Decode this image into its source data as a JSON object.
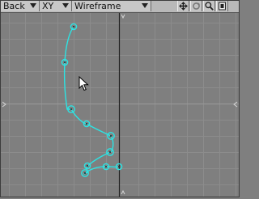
{
  "toolbar": {
    "view_label": "Back",
    "axis_label": "XY",
    "render_mode_label": "Wireframe"
  },
  "icons": {
    "move_view": "move-arrows-icon",
    "rotate_view": "rotate-icon",
    "zoom_view": "magnifier-icon",
    "maximize_view": "maximize-icon",
    "cursor": "mouse-pointer-icon"
  },
  "colors": {
    "viewport_bg": "#7f7f7f",
    "grid": "#8c8c8c",
    "axis": "#222222",
    "curve": "#2ce4e4",
    "point_outline": "#1a2a2a"
  }
}
